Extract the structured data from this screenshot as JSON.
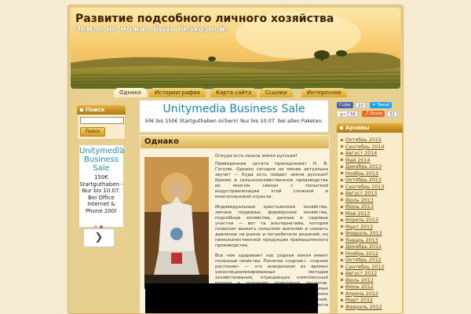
{
  "site": {
    "title": "Развитие подсобного личного хозяйства",
    "tagline": "Земле не можно быть безхозной!"
  },
  "nav": {
    "items": [
      {
        "label": "Однако",
        "active": true
      },
      {
        "label": "Историография",
        "active": false
      },
      {
        "label": "Карта сайта",
        "active": false
      },
      {
        "label": "Ссылки",
        "active": false
      },
      {
        "label": "Интересное",
        "active": false
      }
    ]
  },
  "search": {
    "heading": "Поиск",
    "button_label": "Поиск",
    "input_value": ""
  },
  "ad_left": {
    "title": "Unitymedia Business Sale",
    "body": "150€ Startguthaben - Nur bis 10.07. Bei Office Internet & Phone 200!"
  },
  "ad_top": {
    "title": "Unitymedia Business Sale",
    "subtitle": "50€ bis 150€ Startguthaben sichern! Nur bis 10.07. bei allen Paketen."
  },
  "share": {
    "like_label": "Like",
    "like_count": "22",
    "tweet_label": "Tweet",
    "gplus_label": "+1",
    "gplus_count": "56",
    "share_label": "Share",
    "share_count": "32"
  },
  "post": {
    "title": "Однако",
    "intro": "Откуда есть пошла земля русская?",
    "p1": "Приведенная цитата принадлежит Н. В. Гоголю. Однако сегодня не менее актуально звучит — Куда есть пойдет земля русская? Кризис в сельскохозяйственном производстве во многом связан с попыткой индустриализации этой сложной и многоплановой отрасли.",
    "p2": "Индивидуальные крестьянские хозяйства, личное подворье, фермерские хозяйства, подсобные хозяйства, дачные и садовые участки — вот та альтернатива, которая позволит выжить сельским жителям и снизить давление на рынок и потребителя решений, но низкокачественной продукции промышленного производства.",
    "p3": "Все чем одаривает нас родная земля имеет полезные свойства. Понятие «сорняк», «сорное растение» — это анахронизм из времен узкоспециализированных методов хозяйствования, отрицающих комплексный подход к освоению природных ресурсов. Получив возможность завозить в страну самые экзотические плоды, мы постепенно утрачиваем навыки использования растений, произрастающих в непосредственной близости от нас."
  },
  "archive": {
    "heading": "Архивы",
    "items": [
      "Октябрь 2015",
      "Сентябрь 2014",
      "Август 2014",
      "Май 2014",
      "Декабрь 2013",
      "Ноябрь 2013",
      "Октябрь 2013",
      "Сентябрь 2013",
      "Август 2013",
      "Июль 2013",
      "Июнь 2013",
      "Май 2013",
      "Апрель 2013",
      "Март 2013",
      "Февраль 2013",
      "Январь 2013",
      "Декабрь 2012",
      "Ноябрь 2012",
      "Октябрь 2012",
      "Сентябрь 2012",
      "Август 2012",
      "Июль 2012",
      "Июнь 2012",
      "Апрель 2012",
      "Март 2012",
      "Февраль 2012"
    ]
  }
}
